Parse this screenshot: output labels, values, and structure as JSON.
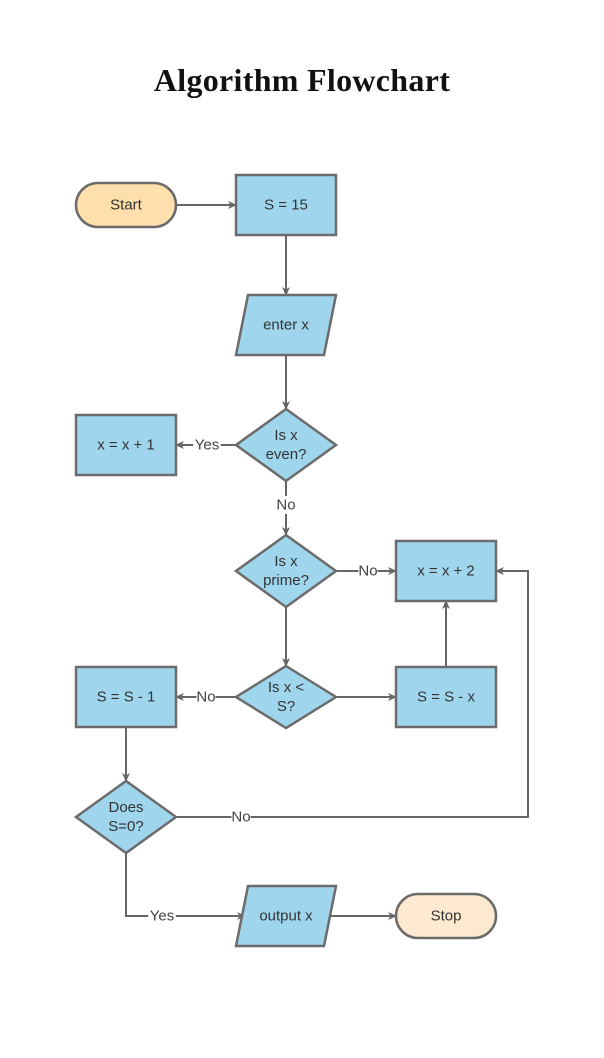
{
  "title": "Algorithm Flowchart",
  "colors": {
    "process_fill": "#9fd6ee",
    "start_fill": "#ffdfab",
    "stop_fill": "#fde8d0",
    "stroke": "#6b6b6b",
    "edge": "#666666"
  },
  "nodes": [
    {
      "id": "start",
      "type": "terminator",
      "lines": [
        "Start"
      ],
      "fill": "start"
    },
    {
      "id": "init-s",
      "type": "process",
      "lines": [
        "S = 15"
      ]
    },
    {
      "id": "enter-x",
      "type": "io",
      "lines": [
        "enter x"
      ]
    },
    {
      "id": "is-even",
      "type": "decision",
      "lines": [
        "Is x",
        "even?"
      ]
    },
    {
      "id": "x-plus-1",
      "type": "process",
      "lines": [
        "x = x + 1"
      ]
    },
    {
      "id": "is-prime",
      "type": "decision",
      "lines": [
        "Is x",
        "prime?"
      ]
    },
    {
      "id": "x-plus-2",
      "type": "process",
      "lines": [
        "x = x + 2"
      ]
    },
    {
      "id": "is-x-less-s",
      "type": "decision",
      "lines": [
        "Is x <",
        "S?"
      ]
    },
    {
      "id": "s-minus-1",
      "type": "process",
      "lines": [
        "S = S - 1"
      ]
    },
    {
      "id": "s-minus-x",
      "type": "process",
      "lines": [
        "S = S - x"
      ]
    },
    {
      "id": "is-s-zero",
      "type": "decision",
      "lines": [
        "Does",
        "S=0?"
      ]
    },
    {
      "id": "output-x",
      "type": "io",
      "lines": [
        "output x"
      ]
    },
    {
      "id": "stop",
      "type": "terminator",
      "lines": [
        "Stop"
      ],
      "fill": "stop"
    }
  ],
  "edges": [
    {
      "from": "start",
      "to": "init-s",
      "label": ""
    },
    {
      "from": "init-s",
      "to": "enter-x",
      "label": ""
    },
    {
      "from": "enter-x",
      "to": "is-even",
      "label": ""
    },
    {
      "from": "is-even",
      "to": "x-plus-1",
      "label": "Yes"
    },
    {
      "from": "is-even",
      "to": "is-prime",
      "label": "No"
    },
    {
      "from": "is-prime",
      "to": "x-plus-2",
      "label": "No"
    },
    {
      "from": "is-prime",
      "to": "is-x-less-s",
      "label": ""
    },
    {
      "from": "is-x-less-s",
      "to": "s-minus-1",
      "label": "No"
    },
    {
      "from": "is-x-less-s",
      "to": "s-minus-x",
      "label": ""
    },
    {
      "from": "s-minus-x",
      "to": "x-plus-2",
      "label": ""
    },
    {
      "from": "s-minus-1",
      "to": "is-s-zero",
      "label": ""
    },
    {
      "from": "is-s-zero",
      "to": "x-plus-2",
      "label": "No"
    },
    {
      "from": "is-s-zero",
      "to": "output-x",
      "label": "Yes"
    },
    {
      "from": "output-x",
      "to": "stop",
      "label": ""
    }
  ]
}
